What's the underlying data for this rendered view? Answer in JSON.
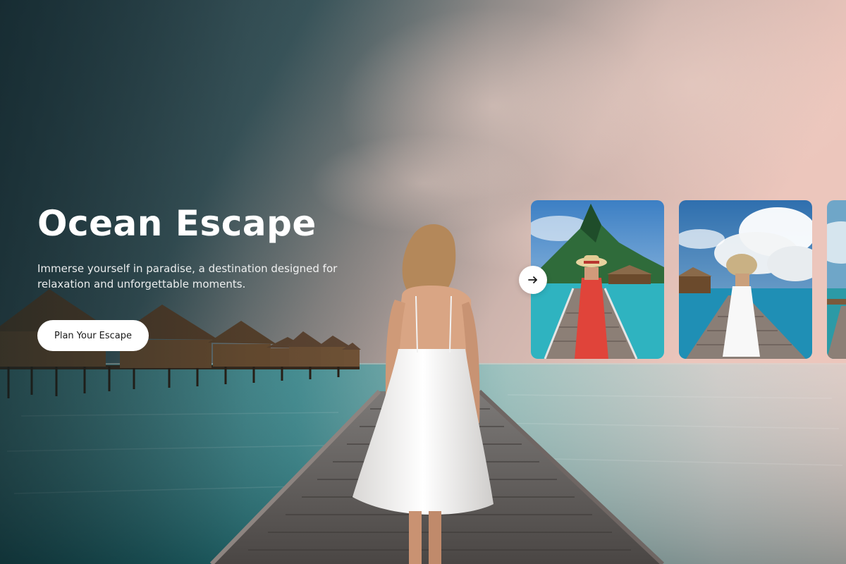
{
  "hero": {
    "title": "Ocean Escape",
    "description": "Immerse yourself in paradise, a destination designed for relaxation and unforgettable moments.",
    "cta_label": "Plan Your Escape"
  },
  "carousel": {
    "cards": [
      {
        "subject": "woman in red dress and straw hat on overwater boardwalk with mountain peak"
      },
      {
        "subject": "woman in white dress and straw hat on boardwalk under cumulus clouds"
      },
      {
        "subject": "tropical lagoon with boardwalk (partially visible)"
      }
    ],
    "next_icon": "arrow-right-icon"
  },
  "colors": {
    "title": "#ffffff",
    "button_bg": "#ffffff",
    "button_text": "#1a1a1a",
    "lagoon": "#2e8f95",
    "sky_dark": "#2f4a55",
    "sky_warm": "#e8c3b8"
  }
}
